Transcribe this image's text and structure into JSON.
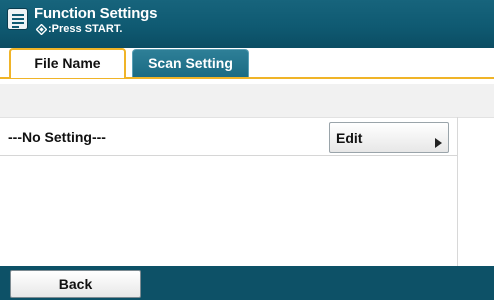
{
  "header": {
    "title": "Function Settings",
    "subtitle": ":Press START.",
    "menu_icon": "menu-list-icon",
    "start_icon": "start-diamond-icon"
  },
  "tabs": [
    {
      "label": "File Name",
      "active": true
    },
    {
      "label": "Scan Setting",
      "active": false
    }
  ],
  "setting": {
    "value": "---No Setting---",
    "edit_label": "Edit",
    "edit_icon": "arrow-right-icon"
  },
  "footer": {
    "back_label": "Back"
  },
  "colors": {
    "header": "#0f5a72",
    "tab_accent": "#f0b428",
    "footer": "#0d5167"
  }
}
